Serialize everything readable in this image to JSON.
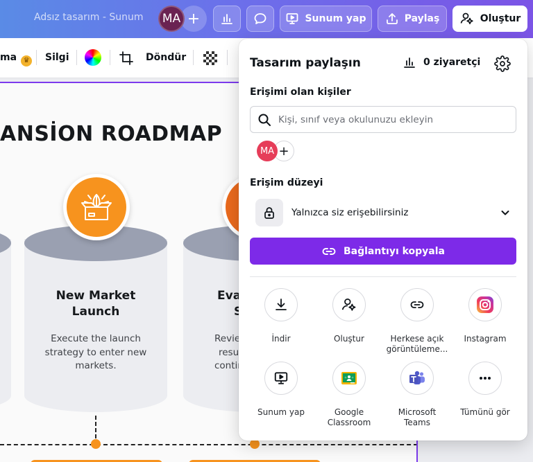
{
  "topbar": {
    "doc_title": "Adsız tasarım - Sunum",
    "avatar_initials": "MA",
    "add_symbol": "+",
    "present_label": "Sunum yap",
    "share_label": "Paylaş",
    "create_label": "Oluştur"
  },
  "toolbar2": {
    "animate_partial": "ma",
    "eraser_label": "Silgi",
    "rotate_label": "Döndür"
  },
  "slide": {
    "title_partial": "ANSİON ROADMAP",
    "steps": [
      {
        "heading_line1": "New Market",
        "heading_line2": "Launch",
        "text_line1": "Execute the launch",
        "text_line2": "strategy to enter new",
        "text_line3": "markets."
      },
      {
        "heading_line1": "Eva",
        "heading_line2": "S",
        "text_line1": "Revie",
        "text_line2": "resu",
        "text_line3": "contin"
      }
    ]
  },
  "share_panel": {
    "title": "Tasarım paylaşın",
    "visitors": "0 ziyaretçi",
    "people_label": "Erişimi olan kişiler",
    "search_placeholder": "Kişi, sınıf veya okulunuzu ekleyin",
    "member_initials": "MA",
    "add_symbol": "+",
    "access_label": "Erişim düzeyi",
    "access_value": "Yalnızca siz erişebilirsiniz",
    "copy_link_label": "Bağlantıyı kopyala",
    "options": [
      {
        "label_line1": "İndir",
        "label_line2": "",
        "icon": "download-icon"
      },
      {
        "label_line1": "Oluştur",
        "label_line2": "",
        "icon": "create-icon"
      },
      {
        "label_line1": "Herkese açık",
        "label_line2": "görüntüleme...",
        "icon": "link-icon"
      },
      {
        "label_line1": "Instagram",
        "label_line2": "",
        "icon": "instagram-icon"
      },
      {
        "label_line1": "Sunum yap",
        "label_line2": "",
        "icon": "present-icon"
      },
      {
        "label_line1": "Google",
        "label_line2": "Classroom",
        "icon": "google-classroom-icon"
      },
      {
        "label_line1": "Microsoft",
        "label_line2": "Teams",
        "icon": "microsoft-teams-icon"
      },
      {
        "label_line1": "Tümünü gör",
        "label_line2": "",
        "icon": "more-icon"
      }
    ]
  },
  "colors": {
    "accent": "#7d2ae8",
    "step_orange": "#f7931e",
    "member_avatar": "#e63d59",
    "top_avatar": "#6a2252"
  }
}
